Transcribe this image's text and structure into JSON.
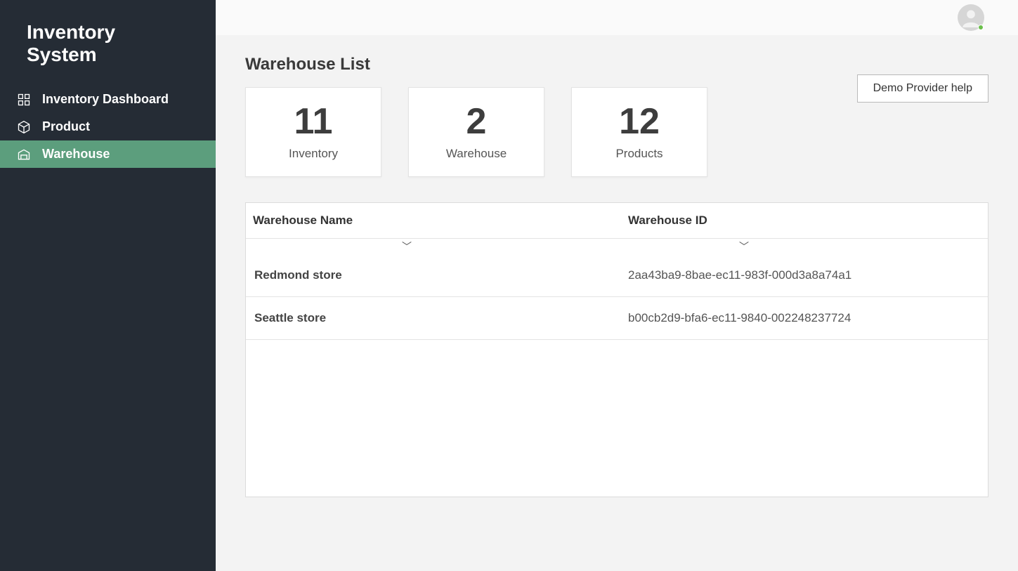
{
  "app": {
    "title": "Inventory System"
  },
  "sidebar": {
    "items": [
      {
        "label": "Inventory Dashboard",
        "icon": "dashboard"
      },
      {
        "label": "Product",
        "icon": "box"
      },
      {
        "label": "Warehouse",
        "icon": "warehouse",
        "active": true
      }
    ]
  },
  "header": {
    "help_label": "Demo Provider help"
  },
  "page": {
    "title": "Warehouse List",
    "stats": [
      {
        "value": "11",
        "label": "Inventory"
      },
      {
        "value": "2",
        "label": "Warehouse"
      },
      {
        "value": "12",
        "label": "Products"
      }
    ],
    "table": {
      "columns": [
        {
          "label": "Warehouse Name"
        },
        {
          "label": "Warehouse ID"
        }
      ],
      "rows": [
        {
          "name": "Redmond store",
          "id": "2aa43ba9-8bae-ec11-983f-000d3a8a74a1"
        },
        {
          "name": "Seattle store",
          "id": "b00cb2d9-bfa6-ec11-9840-002248237724"
        }
      ]
    }
  }
}
